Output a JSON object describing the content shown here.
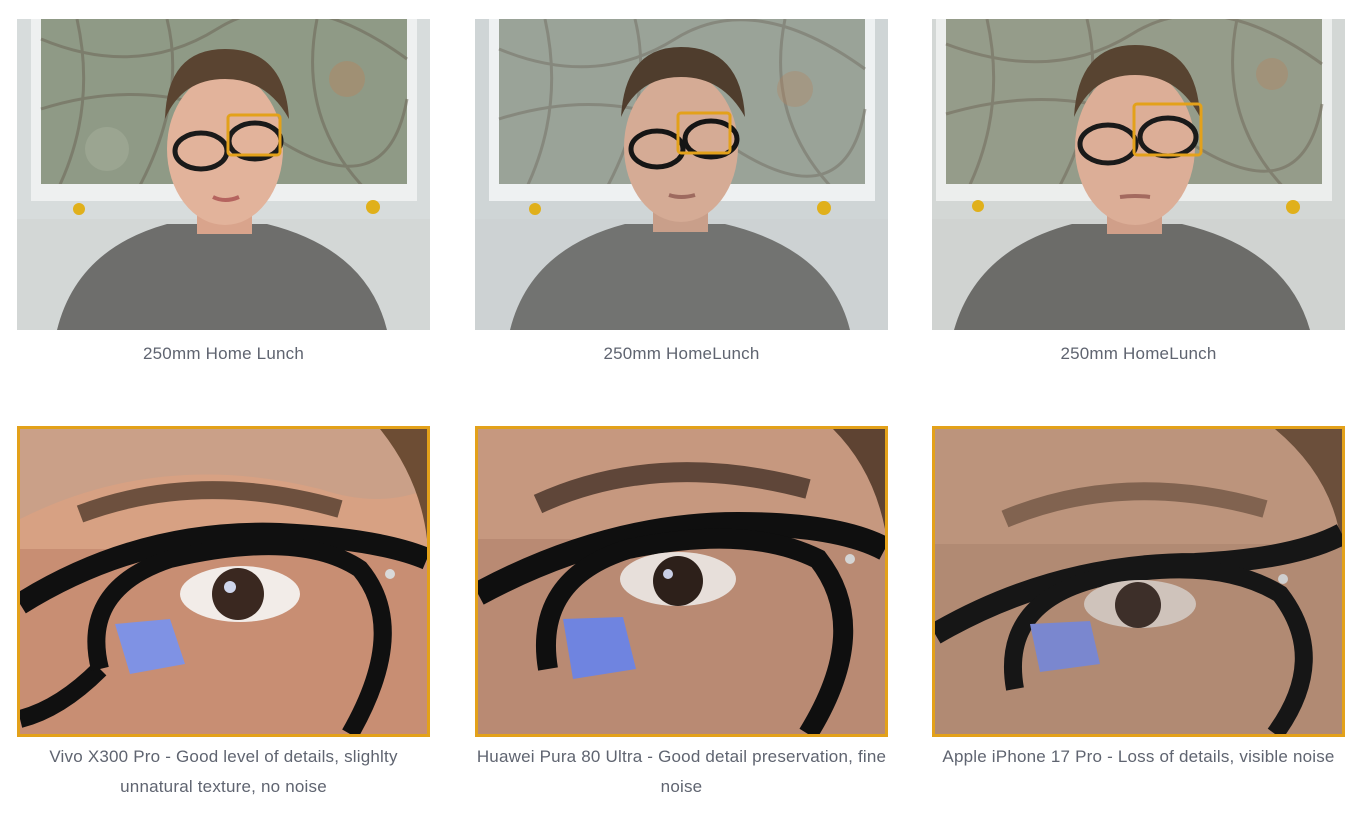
{
  "gallery": {
    "portraits": [
      {
        "caption": "250mm Home Lunch"
      },
      {
        "caption": "250mm HomeLunch"
      },
      {
        "caption": "250mm HomeLunch"
      }
    ],
    "crops": [
      {
        "caption": "Vivo X300 Pro - Good level of details, slighlty unnatural texture, no noise"
      },
      {
        "caption": "Huawei Pura 80 Ultra - Good detail preservation, fine noise"
      },
      {
        "caption": "Apple iPhone 17 Pro - Loss of details, visible noise"
      }
    ]
  },
  "colors": {
    "highlight": "#e3a11a",
    "caption_text": "#5f6470"
  }
}
